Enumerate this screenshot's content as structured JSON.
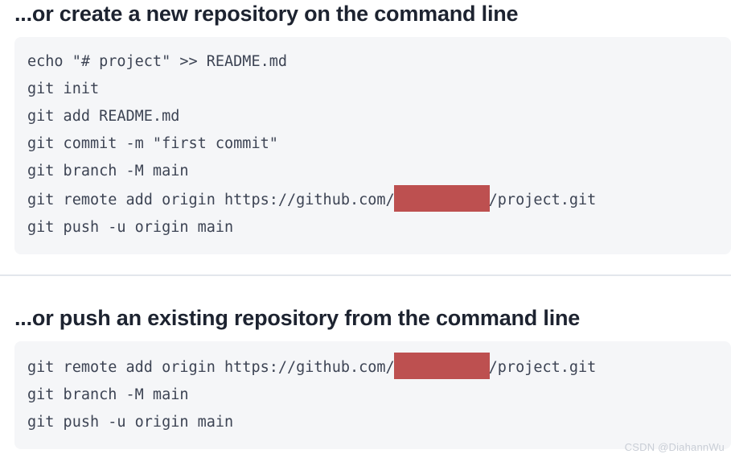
{
  "sections": [
    {
      "id": "create-new-repository",
      "heading": "...or create a new repository on the command line",
      "code_lines": [
        {
          "prefix": "echo \"# project\" >> README.md",
          "redacted": false,
          "suffix": ""
        },
        {
          "prefix": "git init",
          "redacted": false,
          "suffix": ""
        },
        {
          "prefix": "git add README.md",
          "redacted": false,
          "suffix": ""
        },
        {
          "prefix": "git commit -m \"first commit\"",
          "redacted": false,
          "suffix": ""
        },
        {
          "prefix": "git branch -M main",
          "redacted": false,
          "suffix": ""
        },
        {
          "prefix": "git remote add origin https://github.com/",
          "redacted": true,
          "suffix": "/project.git"
        },
        {
          "prefix": "git push -u origin main",
          "redacted": false,
          "suffix": ""
        }
      ]
    },
    {
      "id": "push-existing-repository",
      "heading": "...or push an existing repository from the command line",
      "code_lines": [
        {
          "prefix": "git remote add origin https://github.com/",
          "redacted": true,
          "suffix": "/project.git"
        },
        {
          "prefix": "git branch -M main",
          "redacted": false,
          "suffix": ""
        },
        {
          "prefix": "git push -u origin main",
          "redacted": false,
          "suffix": ""
        }
      ]
    }
  ],
  "watermark": "CSDN @DiahannWu",
  "colors": {
    "heading_text": "#1d2330",
    "code_text": "#3d4454",
    "code_background": "#f5f6f8",
    "redaction_box": "#bd5050",
    "divider": "#e3e7ec",
    "watermark_text": "#c9ced6",
    "page_background": "#ffffff"
  }
}
